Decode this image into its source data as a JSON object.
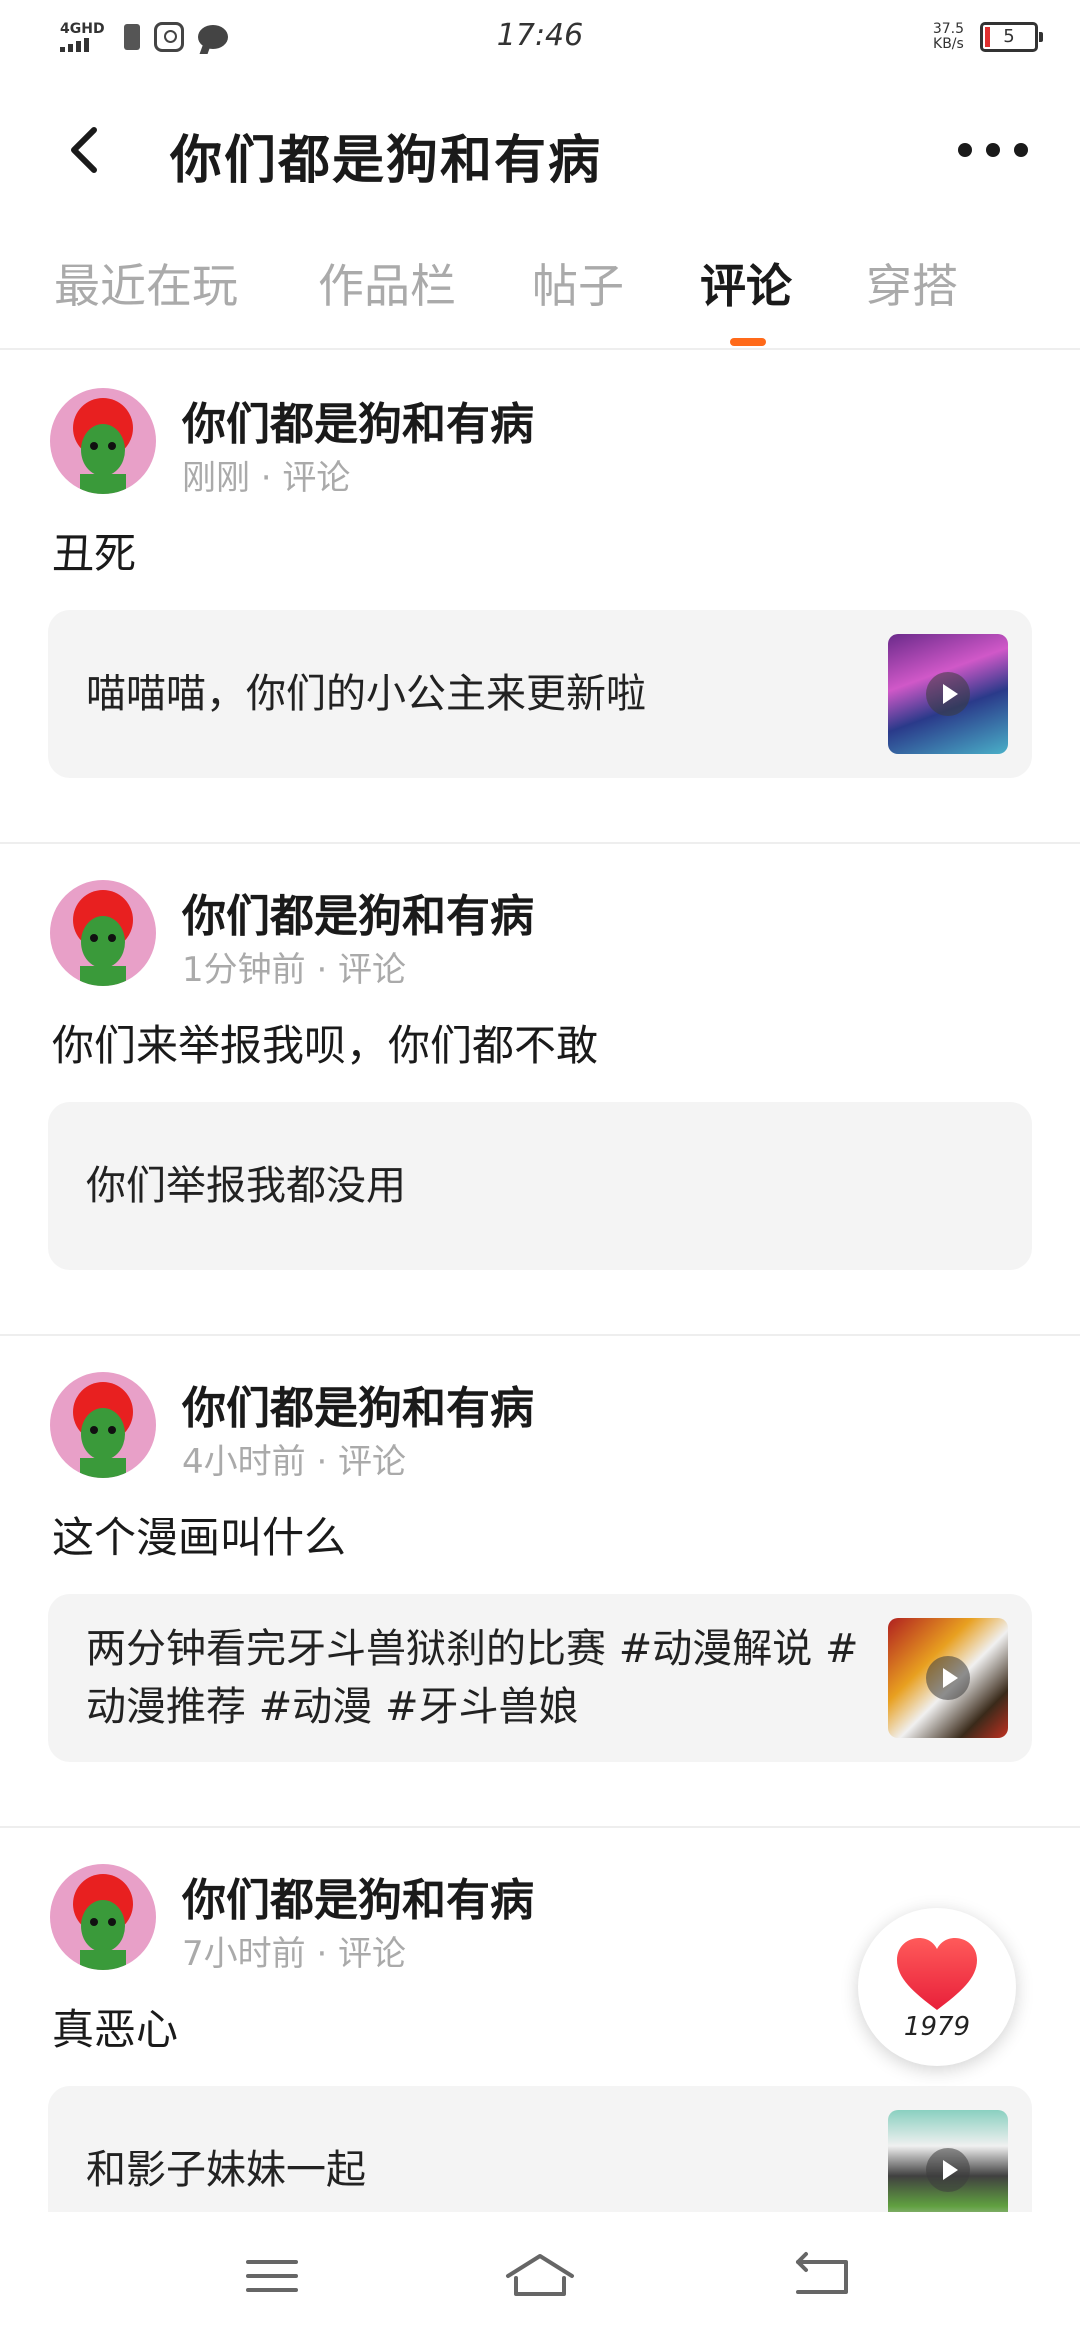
{
  "status_bar": {
    "network": "4GHD",
    "time": "17:46",
    "speed_value": "37.5",
    "speed_unit": "KB/s",
    "battery": "5"
  },
  "header": {
    "title": "你们都是狗和有病",
    "back_icon": "chevron-left-icon",
    "more_icon": "more-horizontal-icon"
  },
  "tabs": [
    {
      "label": "最近在玩",
      "active": false
    },
    {
      "label": "作品栏",
      "active": false
    },
    {
      "label": "帖子",
      "active": false
    },
    {
      "label": "评论",
      "active": true
    },
    {
      "label": "穿搭",
      "active": false
    }
  ],
  "accent_color": "#ff6a1a",
  "posts": [
    {
      "author": "你们都是狗和有病",
      "meta": "刚刚 · 评论",
      "comment": "丑死",
      "ref_text": "喵喵喵，你们的小公主来更新啦",
      "has_thumb": true
    },
    {
      "author": "你们都是狗和有病",
      "meta": "1分钟前 · 评论",
      "comment": "你们来举报我呗，你们都不敢",
      "ref_text": "你们举报我都没用",
      "has_thumb": false
    },
    {
      "author": "你们都是狗和有病",
      "meta": "4小时前 · 评论",
      "comment": "这个漫画叫什么",
      "ref_text": "两分钟看完牙斗兽狱刹的比赛 #动漫解说 #动漫推荐 #动漫 #牙斗兽娘",
      "has_thumb": true
    },
    {
      "author": "你们都是狗和有病",
      "meta": "7小时前 · 评论",
      "comment": "真恶心",
      "ref_text": "和影子妹妹一起",
      "has_thumb": true
    }
  ],
  "like_fab": {
    "count": "1979",
    "icon": "heart-icon"
  },
  "nav_bar": {
    "icons": [
      "menu-icon",
      "home-icon",
      "back-icon"
    ]
  }
}
